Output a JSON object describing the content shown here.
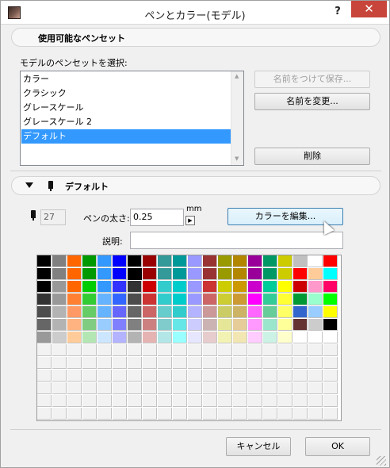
{
  "window": {
    "title": "ペンとカラー(モデル)",
    "help_label": "?",
    "close_label": "✕"
  },
  "available_pensets": {
    "section_label": "使用可能なペンセット",
    "list_label": "モデルのペンセットを選択:",
    "items": [
      "カラー",
      "クラシック",
      "グレースケール",
      "グレースケール 2",
      "デフォルト"
    ],
    "selected_index": 4,
    "save_as_label": "名前をつけて保存...",
    "rename_label": "名前を変更...",
    "delete_label": "削除"
  },
  "pen_section": {
    "section_label": "デフォルト",
    "pen_number": "27",
    "thickness_label": "ペンの太さ:",
    "thickness_value": "0.25",
    "unit": "mm",
    "edit_color_label": "カラーを編集...",
    "description_label": "説明:",
    "description_value": ""
  },
  "palette": {
    "columns": 20,
    "rows": 13,
    "selected_pen": 27,
    "empty_color": "#f2f2f2",
    "colors": [
      [
        "#000000",
        "#808080",
        "#ff6600",
        "#009900",
        "#3399ff",
        "#0000ff",
        "#000000",
        "#990000",
        "#339999",
        "#009999",
        "#9999ff",
        "#993333",
        "#999900",
        "#b38600",
        "#990099",
        "#009966",
        "#cccc00",
        "#c0c0c0",
        "#ffffff",
        "#ff0000"
      ],
      [
        "#000000",
        "#808080",
        "#ff6600",
        "#009900",
        "#3399ff",
        "#0000ff",
        "#000000",
        "#990000",
        "#339999",
        "#009999",
        "#9999ff",
        "#993333",
        "#999900",
        "#b38600",
        "#990099",
        "#009966",
        "#cccc00",
        "#ff0000",
        "#ffcc99",
        "#00ffff"
      ],
      [
        "#000000",
        "#999999",
        "#ff6600",
        "#00cc00",
        "#3399ff",
        "#3333ff",
        "#333333",
        "#cc0000",
        "#33cccc",
        "#00cccc",
        "#9999ff",
        "#cc3333",
        "#cccc00",
        "#cc9900",
        "#cc00cc",
        "#00cc99",
        "#ffff00",
        "#cc0000",
        "#ff99cc",
        "#ff0066"
      ],
      [
        "#333333",
        "#999999",
        "#ff8033",
        "#33cc33",
        "#66b3ff",
        "#3366ff",
        "#4d4d4d",
        "#cc3333",
        "#33cccc",
        "#00cccc",
        "#9999ff",
        "#cc6666",
        "#cccc33",
        "#cc9933",
        "#ff00ff",
        "#33cc99",
        "#ffff33",
        "#009933",
        "#99ffcc",
        "#00ff00"
      ],
      [
        "#4d4d4d",
        "#b3b3b3",
        "#ff9966",
        "#66cc66",
        "#66b3ff",
        "#6666ff",
        "#666666",
        "#cc6666",
        "#66cccc",
        "#33cccc",
        "#b3b3ff",
        "#cc9999",
        "#cccc66",
        "#ccb366",
        "#ff66ff",
        "#66cc99",
        "#ffff66",
        "#3366cc",
        "#99ccff",
        "#ffff00"
      ],
      [
        "#666666",
        "#b3b3b3",
        "#ffb380",
        "#80cc80",
        "#99ccff",
        "#8080ff",
        "#808080",
        "#cc8080",
        "#80cccc",
        "#66e6e6",
        "#ccccff",
        "#ccb3b3",
        "#e6e699",
        "#e6cc99",
        "#ff99ff",
        "#99e6cc",
        "#ffff99",
        "#663333",
        "#cccccc",
        "#000000"
      ],
      [
        "#999999",
        "#cccccc",
        "#ffcc99",
        "#b3e6b3",
        "#cce6ff",
        "#b3b3ff",
        "#b3b3b3",
        "#e6b3b3",
        "#b3e6e6",
        "#99ffff",
        "#e6e6ff",
        "#e6cccc",
        "#f2f2b3",
        "#f2e6b3",
        "#ffccff",
        "#ccf2e6",
        "#ffffcc",
        "#ffffff",
        "#ffffff",
        "#ffffff"
      ]
    ]
  },
  "footer": {
    "cancel_label": "キャンセル",
    "ok_label": "OK"
  }
}
